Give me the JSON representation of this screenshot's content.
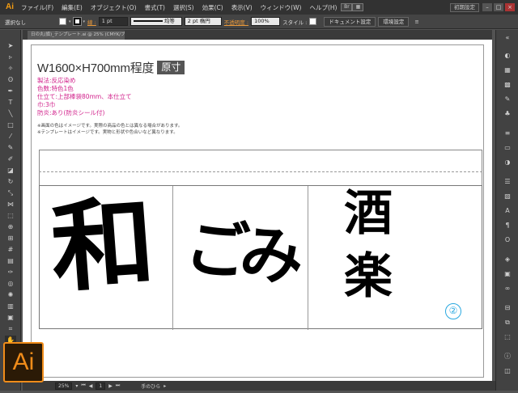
{
  "app": {
    "logo_small": "Ai",
    "logo_large": "Ai",
    "brand_color": "#f08c1a"
  },
  "menu": {
    "items": [
      "ファイル(F)",
      "編集(E)",
      "オブジェクト(O)",
      "書式(T)",
      "選択(S)",
      "効果(C)",
      "表示(V)",
      "ウィンドウ(W)",
      "ヘルプ(H)"
    ],
    "workspace": "初期設定",
    "window_buttons": [
      "–",
      "□",
      "×"
    ]
  },
  "control_bar": {
    "selection_status": "選択なし",
    "stroke_label": "線 :",
    "stroke_weight": "1 pt",
    "stroke_style": "均等",
    "brush": "2 pt 楕円",
    "opacity_label": "不透明度 :",
    "opacity_value": "100%",
    "style_label": "スタイル :",
    "doc_settings_button": "ドキュメント設定",
    "preferences_button": "環境設定"
  },
  "document_tab": {
    "label": "日の丸(旗)_テンプレート.ai @ 25% (CMYK/プレビュー)"
  },
  "artboard": {
    "size_text": "W1600×H700mm程度",
    "size_badge": "原寸",
    "specs": [
      "製法:反応染め",
      "色数:特色1色",
      "仕立て:上部棒袋80mm、本仕立て",
      "巾:3巾",
      "防炎:あり(防炎シール付)"
    ],
    "notes": [
      "※画面の色はイメージです。実際の商品の色とは異なる場合があります。",
      "※テンプレートはイメージです。実物と形状や色合いなど異なります。"
    ],
    "design_text_1": "和",
    "design_text_2": "ごみ",
    "design_text_3a": "酒",
    "design_text_3b": "楽",
    "variant_marker": "②",
    "spec_color": "#d11f8a",
    "marker_color": "#29a8e0"
  },
  "status_bar": {
    "zoom": "25%",
    "page": "1",
    "current_tool": "手のひら"
  },
  "toolbar": {
    "tools": [
      "selection-icon",
      "direct-selection-icon",
      "magic-wand-icon",
      "lasso-icon",
      "pen-icon",
      "type-icon",
      "line-icon",
      "rectangle-icon",
      "paintbrush-icon",
      "pencil-icon",
      "blob-brush-icon",
      "eraser-icon",
      "rotate-icon",
      "scale-icon",
      "width-icon",
      "free-transform-icon",
      "shape-builder-icon",
      "perspective-icon",
      "mesh-icon",
      "gradient-icon",
      "eyedropper-icon",
      "blend-icon",
      "symbol-sprayer-icon",
      "graph-icon",
      "artboard-icon",
      "slice-icon",
      "hand-icon",
      "zoom-icon"
    ]
  }
}
